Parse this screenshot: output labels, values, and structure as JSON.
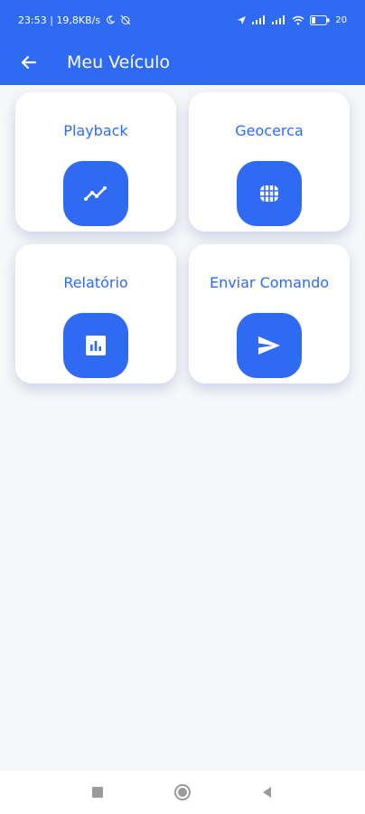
{
  "status_bar": {
    "left_text": "23:53 | 19,8KB/s",
    "battery_text": "20"
  },
  "app_bar": {
    "title": "Meu Veículo",
    "back_icon": "arrow-left-icon"
  },
  "menu": {
    "items": [
      {
        "label": "Playback",
        "icon": "trending-line-icon"
      },
      {
        "label": "Geocerca",
        "icon": "fence-grid-icon"
      },
      {
        "label": "Relatório",
        "icon": "bar-chart-icon"
      },
      {
        "label": "Enviar Comando",
        "icon": "send-icon"
      }
    ]
  },
  "colors": {
    "primary": "#2f6bf2",
    "background": "#f6f7f9",
    "card": "#ffffff"
  },
  "nav_bar": {
    "icons": [
      "recent-apps-icon",
      "home-icon",
      "back-triangle-icon"
    ]
  }
}
